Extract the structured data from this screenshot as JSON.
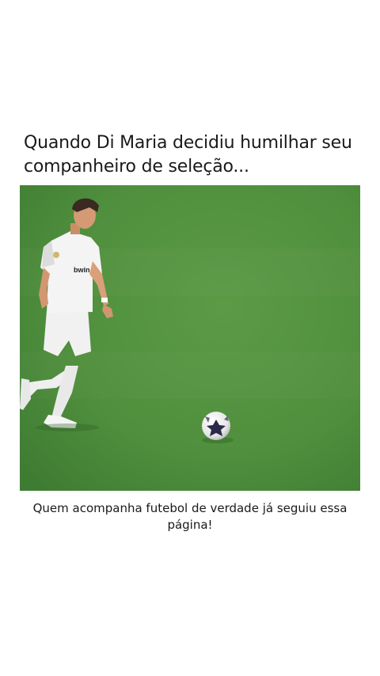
{
  "post": {
    "title": "Quando Di Maria decidiu humilhar seu companheiro de seleção...",
    "caption": "Quem acompanha futebol de verdade já seguiu essa página!"
  },
  "media": {
    "type": "video-frame",
    "jersey_text": "bwin",
    "colors": {
      "pitch": "#4f8f3d",
      "pitch_light": "#5a9a47",
      "kit": "#f2f2f2",
      "skin": "#d9a07a"
    }
  }
}
